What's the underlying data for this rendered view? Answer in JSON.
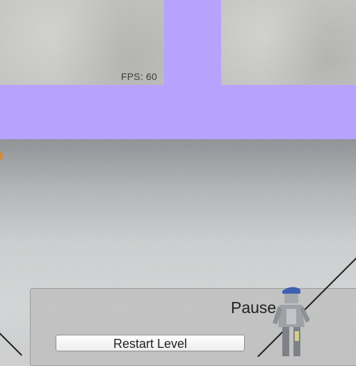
{
  "hud": {
    "fps_text": "FPS: 60"
  },
  "pause_menu": {
    "title": "Pause",
    "restart_label": "Restart Level"
  },
  "colors": {
    "overlay_purple": "#b7a3fe",
    "marker_orange": "#d7883c"
  },
  "icons": [
    "character-sprite"
  ]
}
